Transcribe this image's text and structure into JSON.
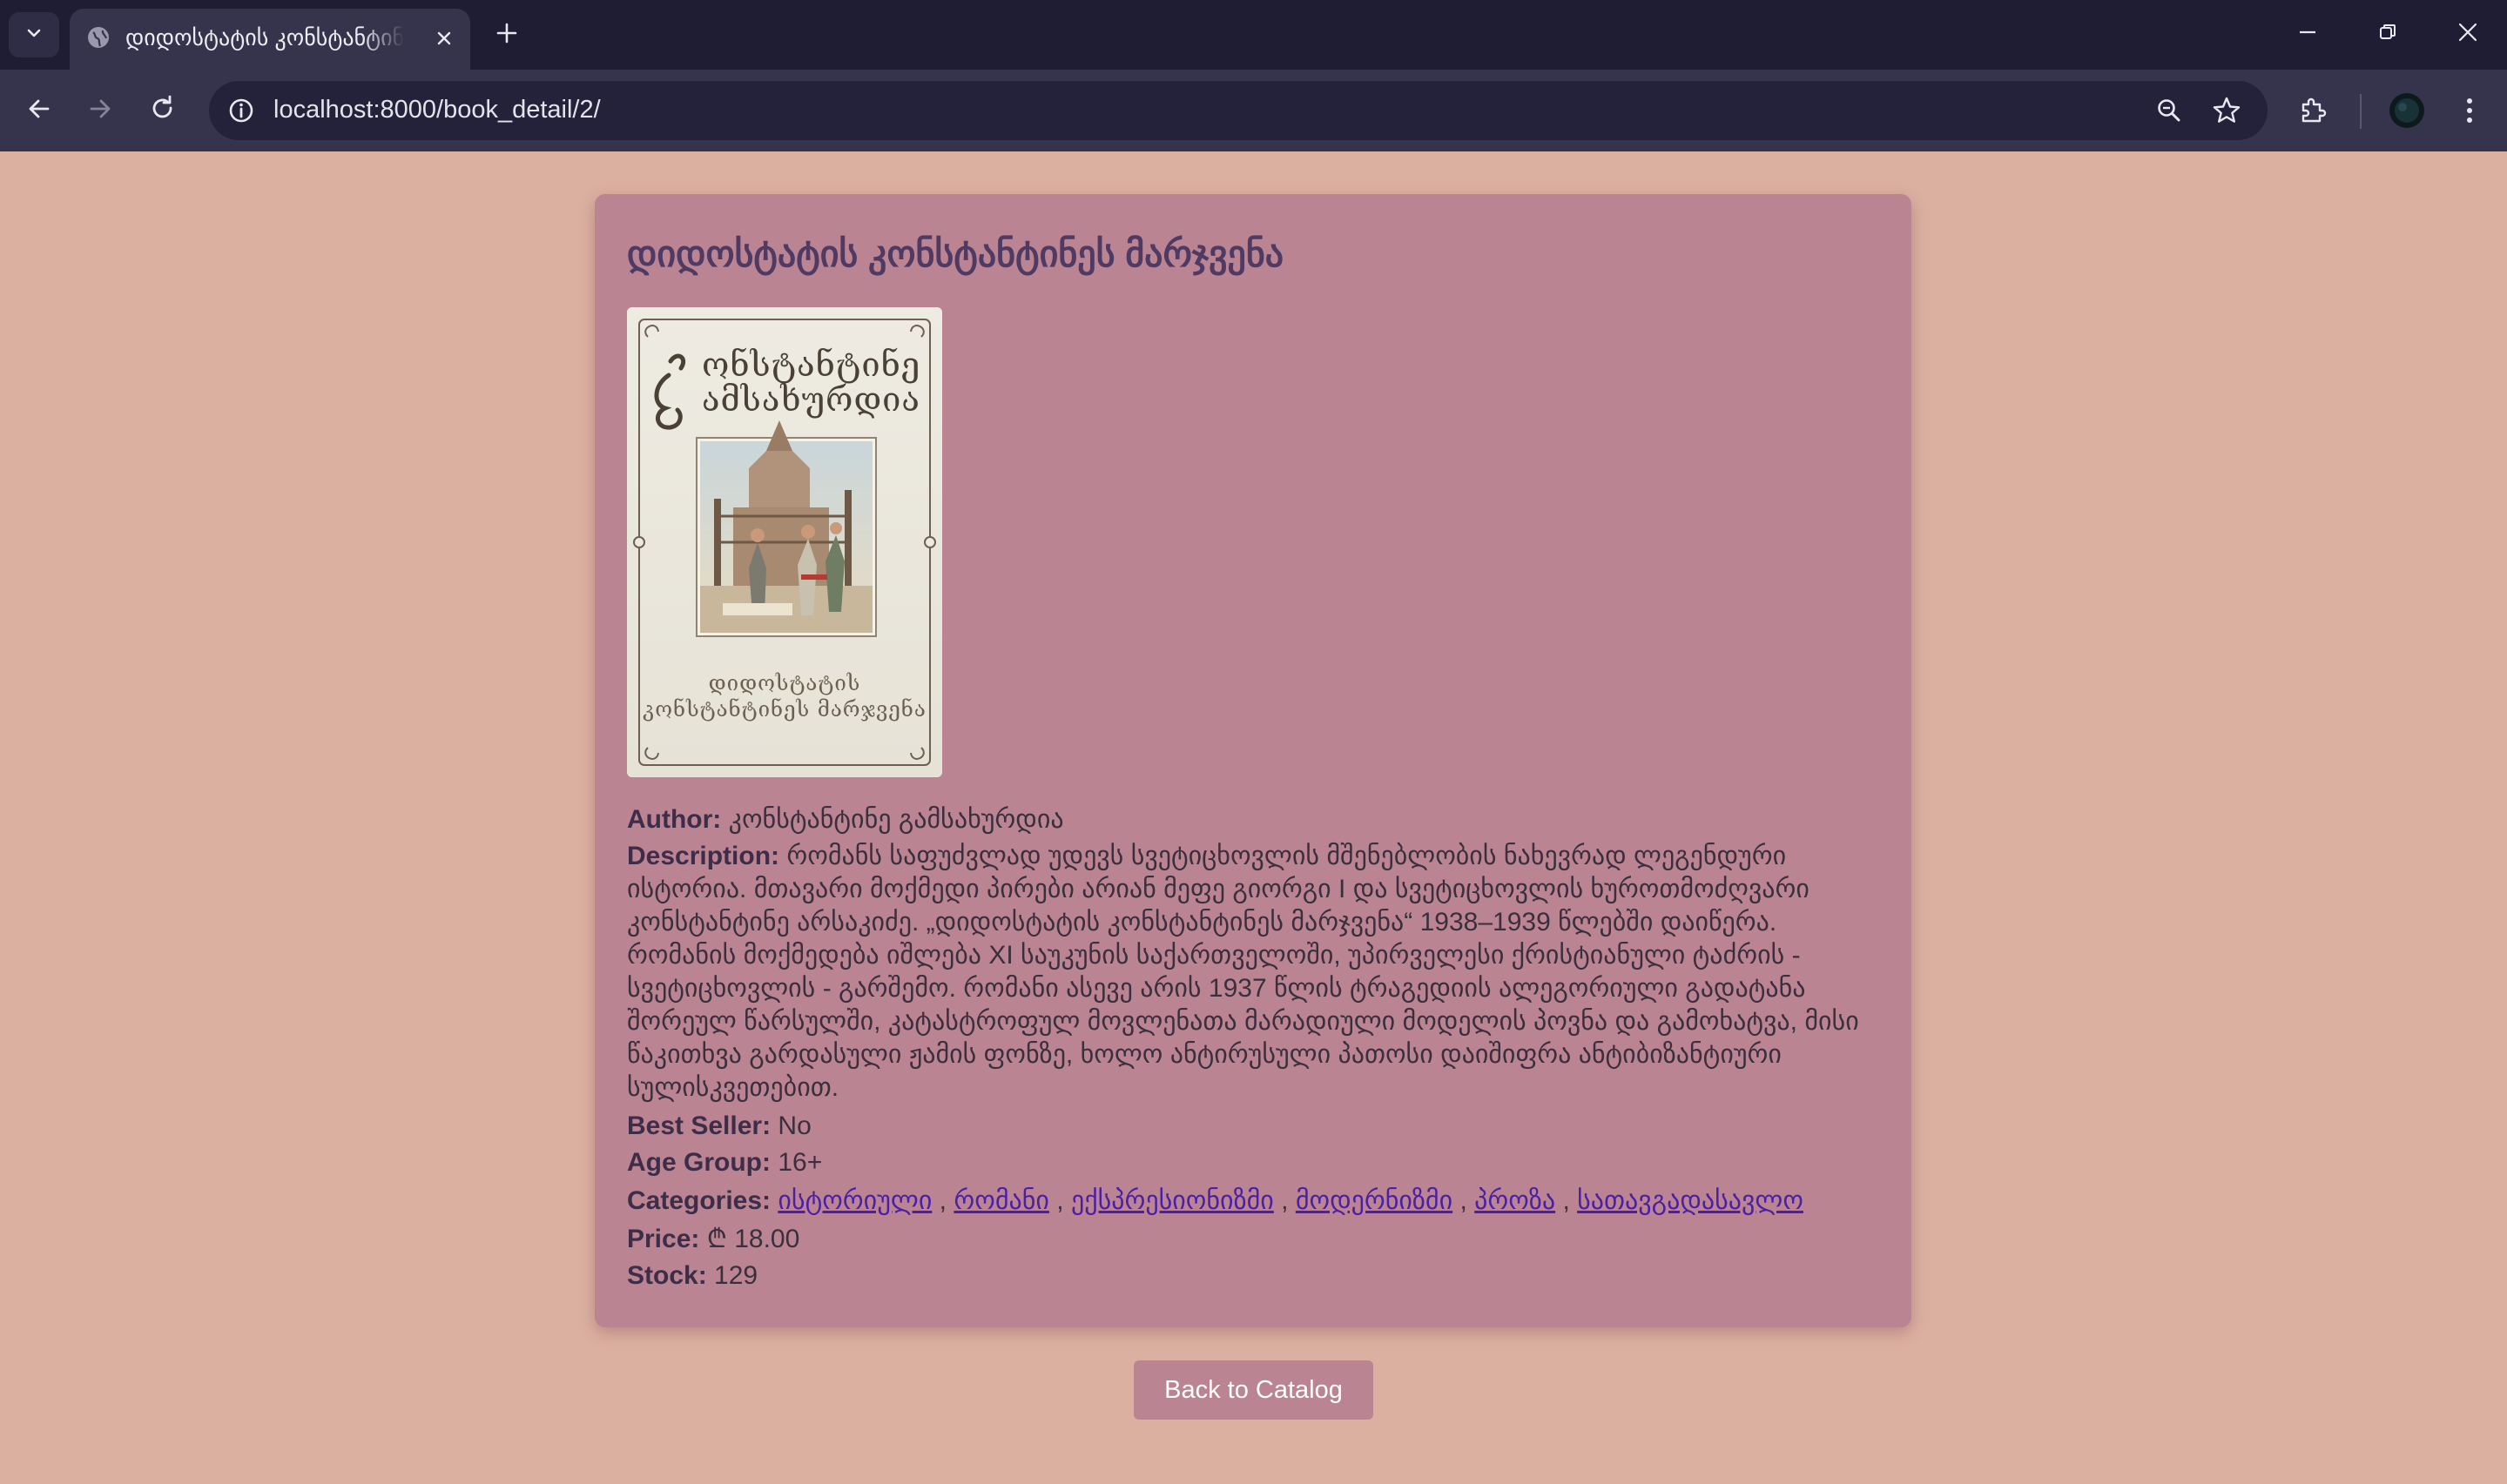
{
  "browser": {
    "tab_title": "დიდოსტატის კონსტანტინეს მარჯვენა",
    "url": "localhost:8000/book_detail/2/"
  },
  "book": {
    "title": "დიდოსტატის კონსტანტინეს მარჯვენა",
    "cover": {
      "top_title_line1": "ონსტანტინე",
      "top_title_line2": "ამსახურდია",
      "bottom_title_line1": "დიდოსტატის",
      "bottom_title_line2": "კონსტანტინეს მარჯვენა"
    },
    "author_label": "Author:",
    "author": "კონსტანტინე გამსახურდია",
    "description_label": "Description:",
    "description": "რომანს საფუძვლად უდევს სვეტიცხოვლის მშენებლობის ნახევრად ლეგენდური ისტორია. მთავარი მოქმედი პირები არიან მეფე გიორგი I და სვეტიცხოვლის ხუროთმოძღვარი კონსტანტინე არსაკიძე. „დიდოსტატის კონსტანტინეს მარჯვენა“ 1938–1939 წლებში დაიწერა. რომანის მოქმედება იშლება XI საუკუნის საქართველოში, უპირველესი ქრისტიანული ტაძრის - სვეტიცხოვლის - გარშემო. რომანი ასევე არის 1937 წლის ტრაგედიის ალეგორიული გადატანა შორეულ წარსულში, კატასტროფულ მოვლენათა მარადიული მოდელის პოვნა და გამოხატვა, მისი წაკითხვა გარდასული ჟამის ფონზე, ხოლო ანტირუსული პათოსი დაიშიფრა ანტიბიზანტიური სულისკვეთებით.",
    "bestseller_label": "Best Seller:",
    "bestseller": "No",
    "age_label": "Age Group:",
    "age": "16+",
    "categories_label": "Categories:",
    "categories": [
      "ისტორიული",
      "რომანი",
      "ექსპრესიონიზმი",
      "მოდერნიზმი",
      "პროზა",
      "სათავგადასავლო"
    ],
    "category_sep": " , ",
    "price_label": "Price:",
    "price": "₾ 18.00",
    "stock_label": "Stock:",
    "stock": "129"
  },
  "actions": {
    "back_label": "Back to Catalog"
  },
  "colors": {
    "page_bg": "#dcb0a1",
    "card_bg": "#bb8492",
    "title_color": "#4f3a63",
    "link_color": "#4b1fa6"
  }
}
